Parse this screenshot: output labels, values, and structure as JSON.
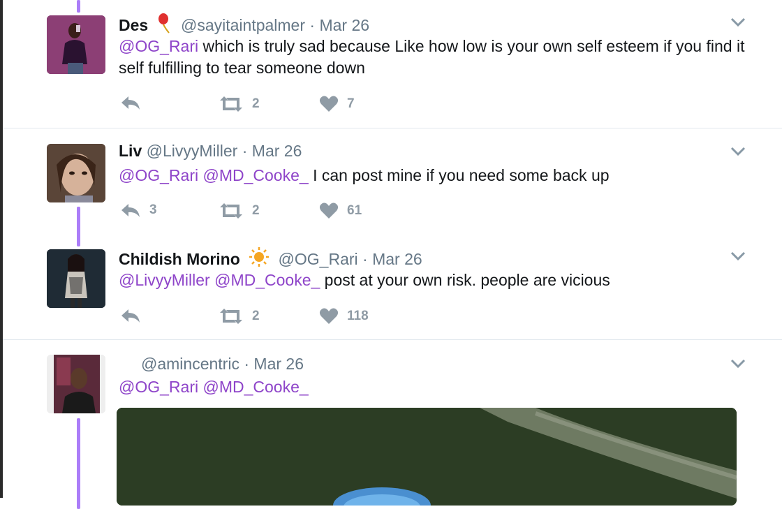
{
  "tweets": [
    {
      "name": "Des",
      "handle": "@sayitaintpalmer",
      "sep": "·",
      "date": "Mar 26",
      "mentions": [
        "@OG_Rari"
      ],
      "text": "which is truly sad because Like how low is your own self esteem if you find it self fulfilling to tear someone down",
      "reply_count": "",
      "retweet_count": "2",
      "like_count": "7",
      "name_emoji": "balloon-icon"
    },
    {
      "name": "Liv",
      "handle": "@LivyyMiller",
      "sep": "·",
      "date": "Mar 26",
      "mentions": [
        "@OG_Rari",
        "@MD_Cooke_"
      ],
      "text": "I can post mine if you need some back up",
      "reply_count": "3",
      "retweet_count": "2",
      "like_count": "61"
    },
    {
      "name": "Childish Morino",
      "handle": "@OG_Rari",
      "sep": "·",
      "date": "Mar 26",
      "mentions": [
        "@LivyyMiller",
        "@MD_Cooke_"
      ],
      "text": "post at your own risk. people are vicious",
      "reply_count": "",
      "retweet_count": "2",
      "like_count": "118",
      "name_emoji": "sun-icon"
    },
    {
      "name": "",
      "handle": "@amincentric",
      "sep": "·",
      "date": "Mar 26",
      "mentions": [
        "@OG_Rari",
        "@MD_Cooke_"
      ],
      "text": "",
      "media": "image-preview"
    }
  ],
  "colors": {
    "mention": "#8e44c9",
    "thread_line": "#ab7df8",
    "action_gray": "#8f9ba5",
    "meta_gray": "#657786"
  }
}
